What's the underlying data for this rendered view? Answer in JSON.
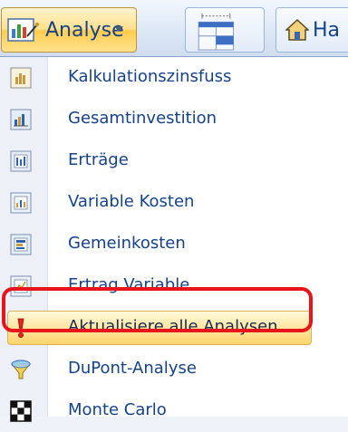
{
  "ribbon": {
    "analyse_label": "Analyse",
    "home_label": "Ha"
  },
  "menu": {
    "items": [
      {
        "label": "Kalkulationszinsfuss",
        "icon": "chart-sheet-icon"
      },
      {
        "label": "Gesamtinvestition",
        "icon": "chart-sheet-icon"
      },
      {
        "label": "Erträge",
        "icon": "chart-sheet-icon"
      },
      {
        "label": "Variable Kosten",
        "icon": "chart-sheet-icon"
      },
      {
        "label": "Gemeinkosten",
        "icon": "chart-sheet-icon"
      },
      {
        "label": "Ertrag Variable",
        "icon": "chart-sheet-icon"
      },
      {
        "label": "Aktualisiere alle Analysen",
        "icon": "exclamation-icon"
      },
      {
        "label": "DuPont-Analyse",
        "icon": "funnel-icon"
      },
      {
        "label": "Monte Carlo",
        "icon": "checkerboard-icon"
      }
    ]
  },
  "colors": {
    "highlight": "#ffe08c",
    "annotation_ring": "#e8141c",
    "menu_text": "#15428b"
  }
}
